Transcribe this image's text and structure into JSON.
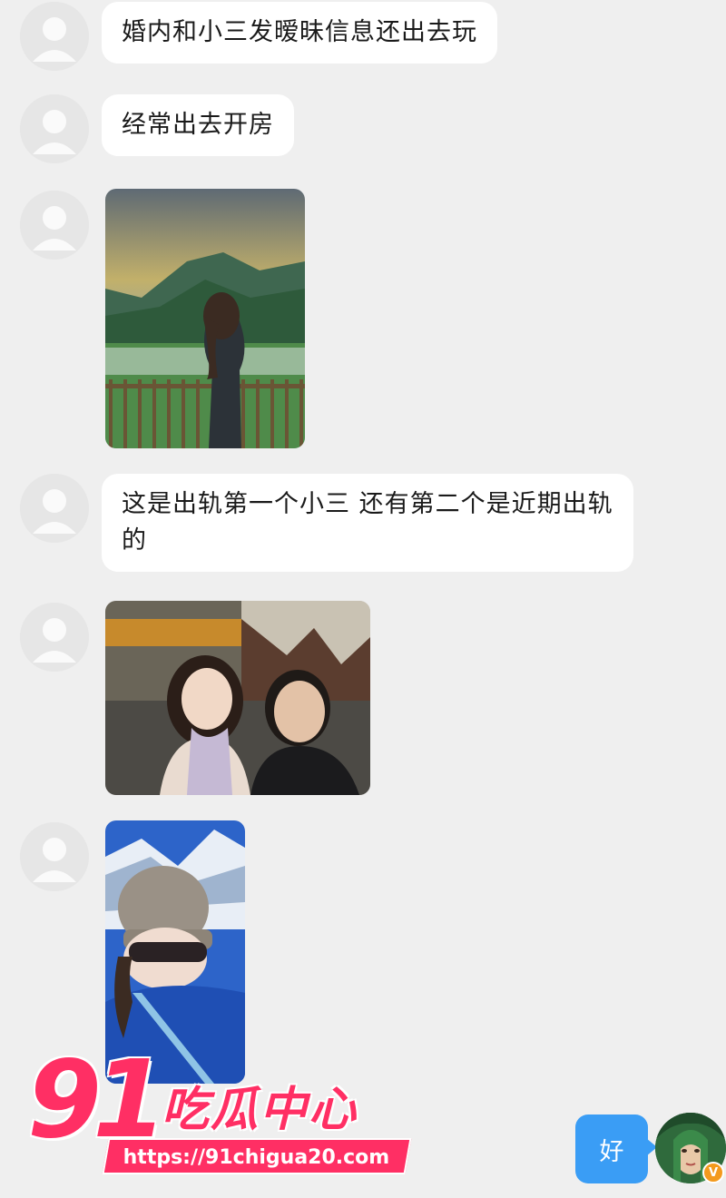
{
  "messages": [
    {
      "kind": "text",
      "text": "婚内和小三发暧昧信息还出去玩"
    },
    {
      "kind": "text",
      "text": "经常出去开房"
    },
    {
      "kind": "image",
      "subject": "woman-by-fence-mountain-sunset-photo"
    },
    {
      "kind": "text",
      "text": "这是出轨第一个小三 还有第二个是近期出轨的"
    },
    {
      "kind": "image",
      "subject": "couple-selfie-photo"
    },
    {
      "kind": "image",
      "subject": "woman-ski-selfie-photo"
    }
  ],
  "my_reply": {
    "text": "好"
  },
  "my_avatar": {
    "badge": "V"
  },
  "watermark": {
    "number": "91",
    "name": "吃瓜中心",
    "url": "https://91chigua20.com"
  },
  "colors": {
    "background": "#efefef",
    "bubble_other": "#ffffff",
    "bubble_mine": "#3a9df5",
    "watermark": "#ff2f64",
    "vip_badge": "#f39a1d"
  }
}
